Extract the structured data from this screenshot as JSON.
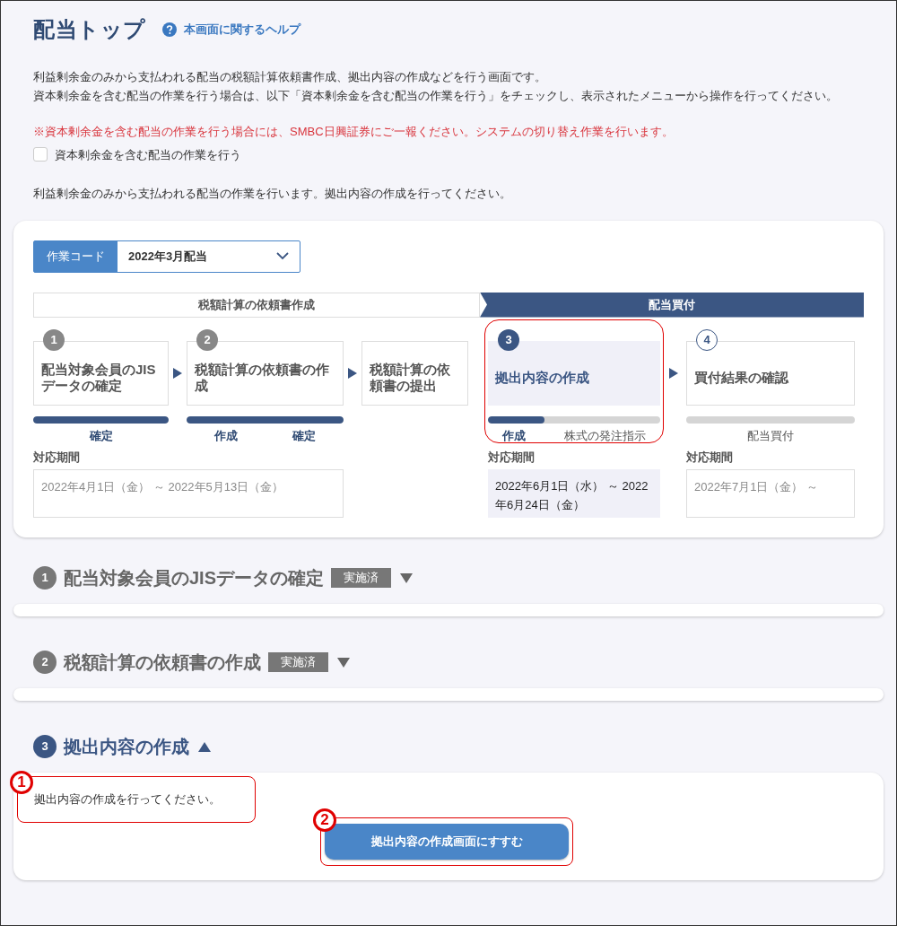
{
  "page": {
    "title": "配当トップ",
    "help_link": "本画面に関するヘルプ"
  },
  "intro": [
    "利益剰余金のみから支払われる配当の税額計算依頼書作成、拠出内容の作成などを行う画面です。",
    "資本剰余金を含む配当の作業を行う場合は、以下「資本剰余金を含む配当の作業を行う」をチェックし、表示されたメニューから操作を行ってください。"
  ],
  "notice": "※資本剰余金を含む配当の作業を行う場合には、SMBC日興証券にご一報ください。システムの切り替え作業を行います。",
  "checkbox": {
    "label": "資本剰余金を含む配当の作業を行う",
    "checked": false
  },
  "status_text": "利益剰余金のみから支払われる配当の作業を行います。拠出内容の作成を行ってください。",
  "work_code": {
    "label": "作業コード",
    "value": "2022年3月配当"
  },
  "phases": [
    {
      "label": "税額計算の依頼書作成",
      "selected": false
    },
    {
      "label": "配当買付",
      "selected": true
    }
  ],
  "steps": [
    {
      "number": "1",
      "title": "配当対象会員のJISデータの確定",
      "done": true,
      "selected": false,
      "annotated": false,
      "bar": {
        "level": 1,
        "labels": [
          "確定"
        ]
      }
    },
    {
      "number": "2",
      "title": "税額計算の依頼書の作成",
      "done": true,
      "selected": false,
      "annotated": false,
      "bar": {
        "level": 1,
        "labels": [
          "作成",
          "確定"
        ]
      }
    },
    {
      "title": "税額計算の依頼書の提出",
      "selected": false,
      "annotated": false
    },
    {
      "number": "3",
      "title": "拠出内容の作成",
      "done": false,
      "selected": true,
      "annotated": true,
      "bar": {
        "level": 0.33,
        "labels": [
          "作成",
          "株式の発注指示"
        ]
      }
    },
    {
      "number": "4",
      "title": "買付結果の確認",
      "done": false,
      "selected": false,
      "annotated": false,
      "bar": {
        "level": 0,
        "labels": [
          "配当買付"
        ]
      }
    }
  ],
  "periods": [
    {
      "label": "対応期間",
      "value": "2022年4月1日（金） ～ 2022年5月13日（金）",
      "selected": false
    },
    {
      "label": "対応期間",
      "value": "2022年6月1日（水） ～ 2022年6月24日（金）",
      "selected": true
    },
    {
      "label": "対応期間",
      "value": "2022年7月1日（金） ～",
      "selected": false
    }
  ],
  "sections": [
    {
      "number": "1",
      "title": "配当対象会員のJISデータの確定",
      "badge": "実施済",
      "selected": false,
      "expanded": false
    },
    {
      "number": "2",
      "title": "税額計算の依頼書の作成",
      "badge": "実施済",
      "selected": false,
      "expanded": false
    },
    {
      "number": "3",
      "title": "拠出内容の作成",
      "selected": true,
      "expanded": true,
      "message": "拠出内容の作成を行ってください。",
      "message_callout": "1",
      "button": "拠出内容の作成画面にすすむ",
      "button_callout": "2"
    }
  ]
}
